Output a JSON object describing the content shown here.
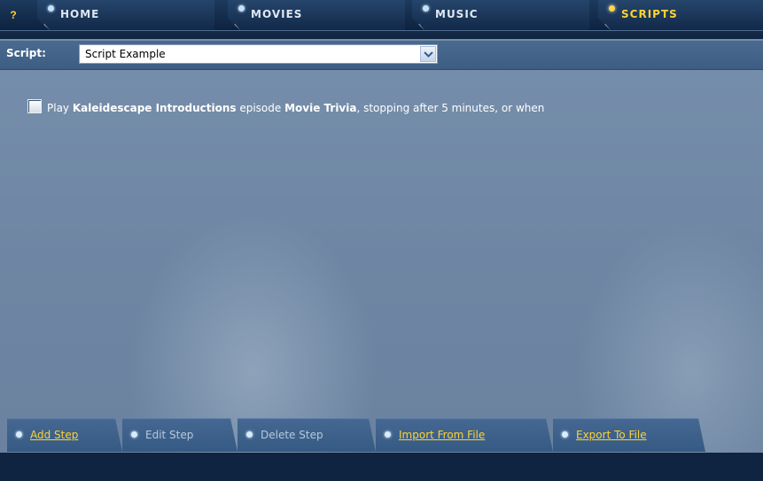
{
  "nav": {
    "help_label": "?",
    "tabs": [
      {
        "label": "HOME",
        "active": false
      },
      {
        "label": "MOVIES",
        "active": false
      },
      {
        "label": "MUSIC",
        "active": false
      },
      {
        "label": "SCRIPTS",
        "active": true
      }
    ]
  },
  "script_bar": {
    "label": "Script:",
    "selected": "Script Example"
  },
  "steps": [
    {
      "checked": false,
      "parts": {
        "t1": "Play ",
        "b1": "Kaleidescape Introductions",
        "t2": " episode ",
        "b2": "Movie Trivia",
        "t3": ", stopping after 5 minutes, or when"
      }
    }
  ],
  "actions": [
    {
      "label": "Add Step",
      "enabled": true
    },
    {
      "label": "Edit Step",
      "enabled": false
    },
    {
      "label": "Delete Step",
      "enabled": false
    },
    {
      "label": "Import From File",
      "enabled": true
    },
    {
      "label": "Export To File",
      "enabled": true
    }
  ],
  "colors": {
    "accent": "#ffd232",
    "nav_bg": "#0f2440",
    "content_bg": "#6e86a3"
  }
}
